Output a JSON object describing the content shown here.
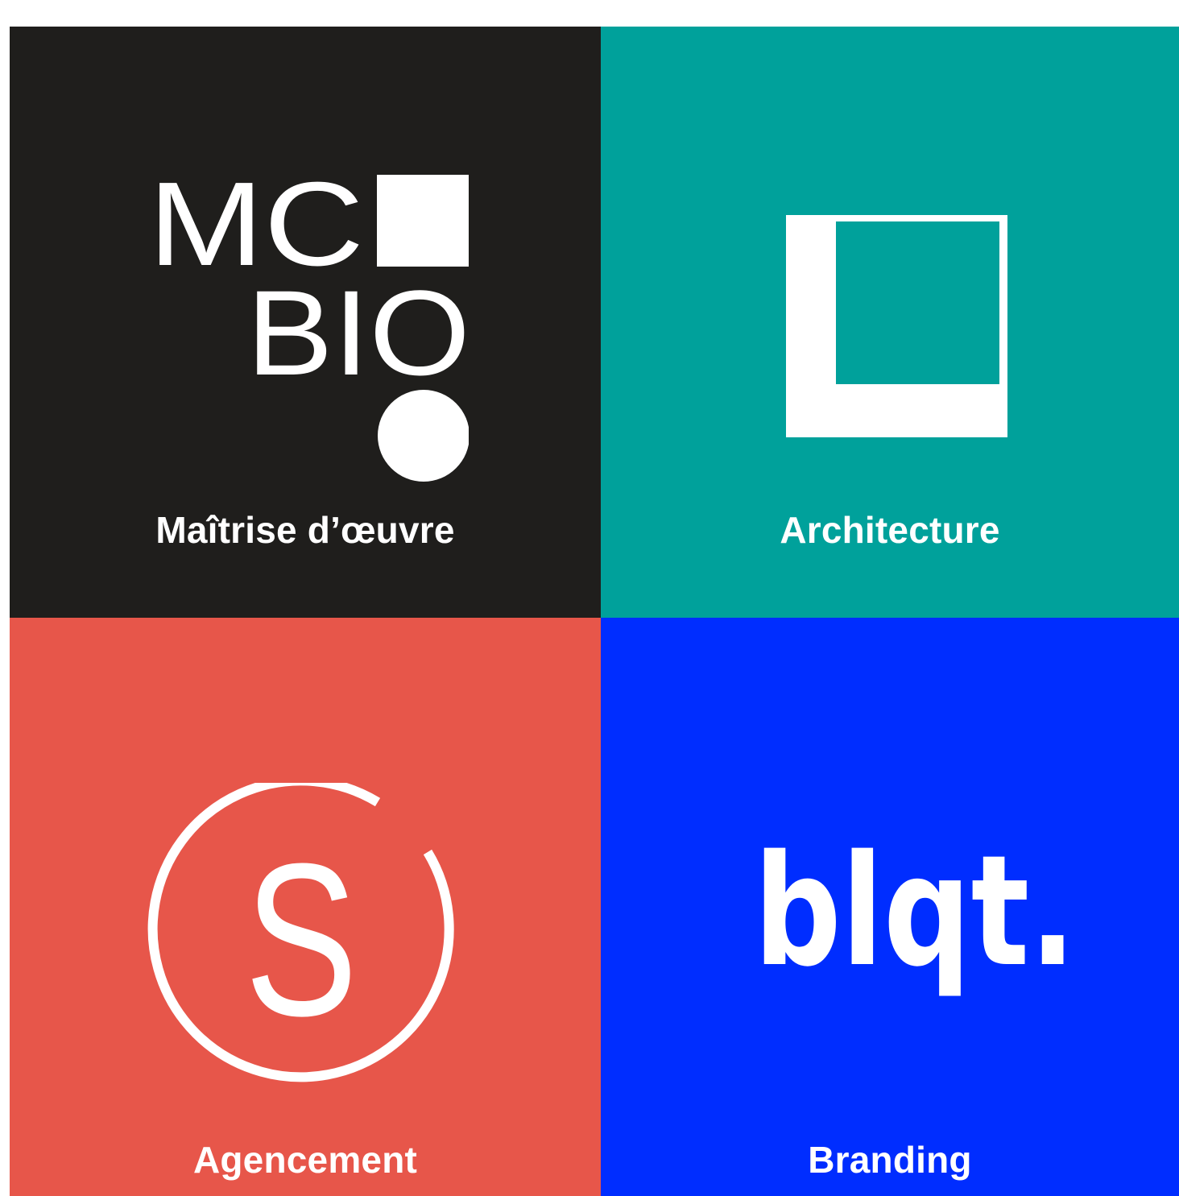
{
  "colors": {
    "page_background": "#ffffff",
    "tile_dark": "#1f1e1c",
    "tile_teal": "#00a19b",
    "tile_coral": "#e7564a",
    "tile_blue": "#002dff",
    "logo_white": "#ffffff"
  },
  "tiles": [
    {
      "label": "Maîtrise d’œuvre",
      "logo_lines": [
        "MC",
        "BIO"
      ],
      "logo_icon": "mcbio-square-circle-icon"
    },
    {
      "label": "Architecture",
      "logo_icon": "offset-square-icon"
    },
    {
      "label": "Agencement",
      "logo_letter": "S",
      "logo_icon": "s-circle-icon"
    },
    {
      "label": "Branding",
      "logo_text": "blqt.",
      "logo_icon": "blqt-wordmark-icon"
    }
  ]
}
